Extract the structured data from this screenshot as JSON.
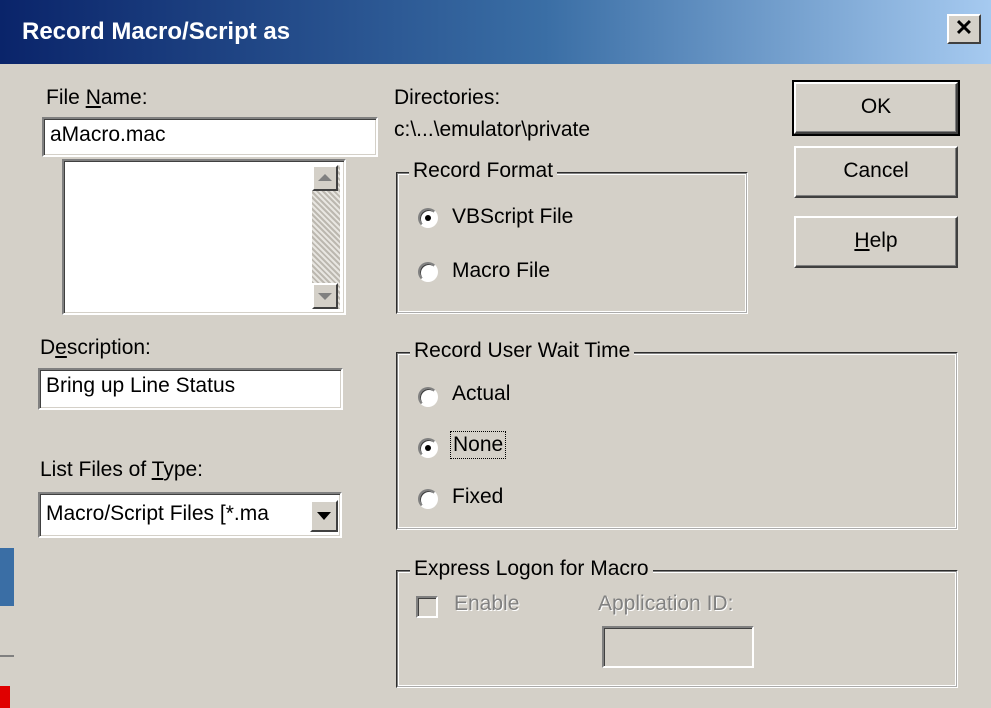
{
  "window": {
    "title": "Record Macro/Script as",
    "close_symbol": "✕"
  },
  "file_name": {
    "label_pre": "File ",
    "label_u": "N",
    "label_post": "ame:",
    "value": "aMacro.mac"
  },
  "directories": {
    "label": "Directories:",
    "path": "c:\\...\\emulator\\private"
  },
  "description": {
    "label_pre": "D",
    "label_u": "e",
    "label_post": "scription:",
    "value": "Bring up Line Status"
  },
  "list_type": {
    "label_pre": "List Files of ",
    "label_u": "T",
    "label_post": "ype:",
    "value": "Macro/Script Files [*.ma"
  },
  "buttons": {
    "ok": "OK",
    "cancel": "Cancel",
    "help_u": "H",
    "help_rest": "elp"
  },
  "record_format": {
    "legend": "Record Format",
    "options": [
      "VBScript File",
      "Macro File"
    ],
    "selected": 0
  },
  "wait_time": {
    "legend": "Record User Wait Time",
    "options": [
      "Actual",
      "None",
      "Fixed"
    ],
    "selected": 1
  },
  "express_logon": {
    "legend": "Express Logon for Macro",
    "enable_label": "Enable",
    "app_id_label": "Application ID:"
  }
}
